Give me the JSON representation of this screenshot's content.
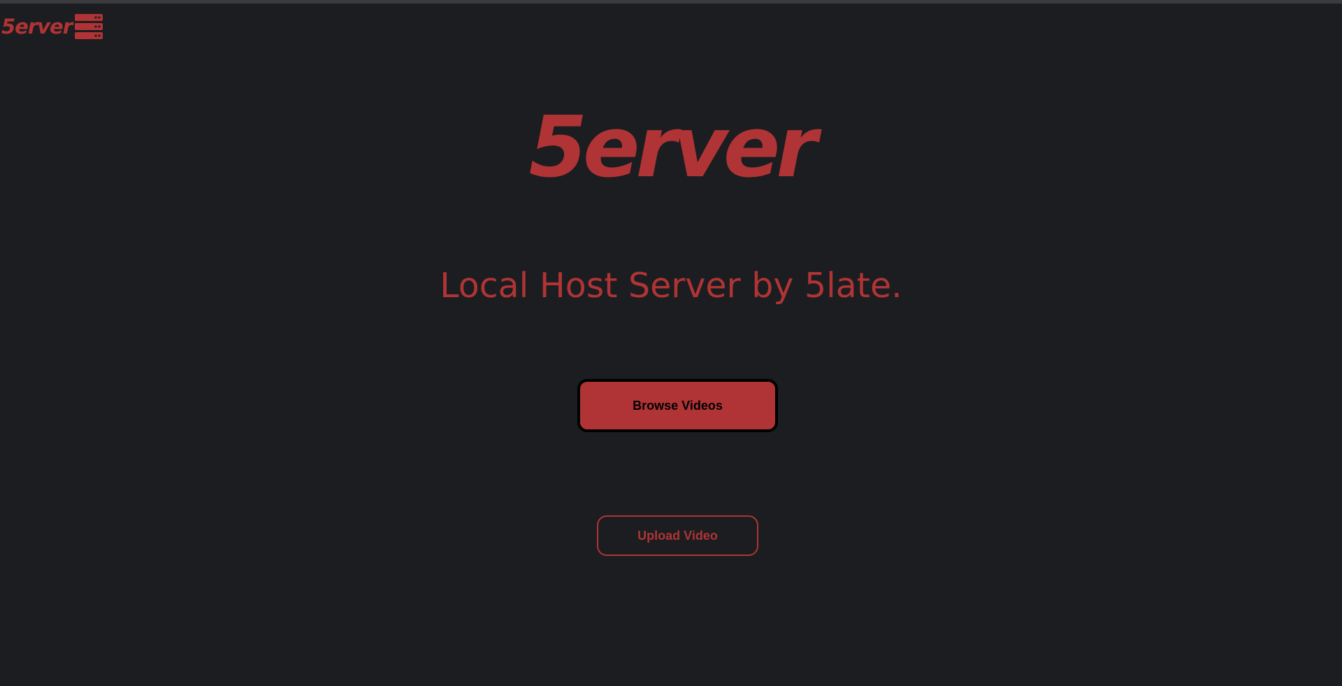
{
  "header": {
    "logo_text": "5erver",
    "logo_icon": "server-stack-icon"
  },
  "hero": {
    "logo_text": "5erver",
    "tagline": "Local Host Server by 5late."
  },
  "actions": {
    "browse_label": "Browse Videos",
    "upload_label": "Upload Video"
  },
  "colors": {
    "background": "#1b1d20",
    "accent": "#b03435",
    "button_border": "#000000"
  }
}
